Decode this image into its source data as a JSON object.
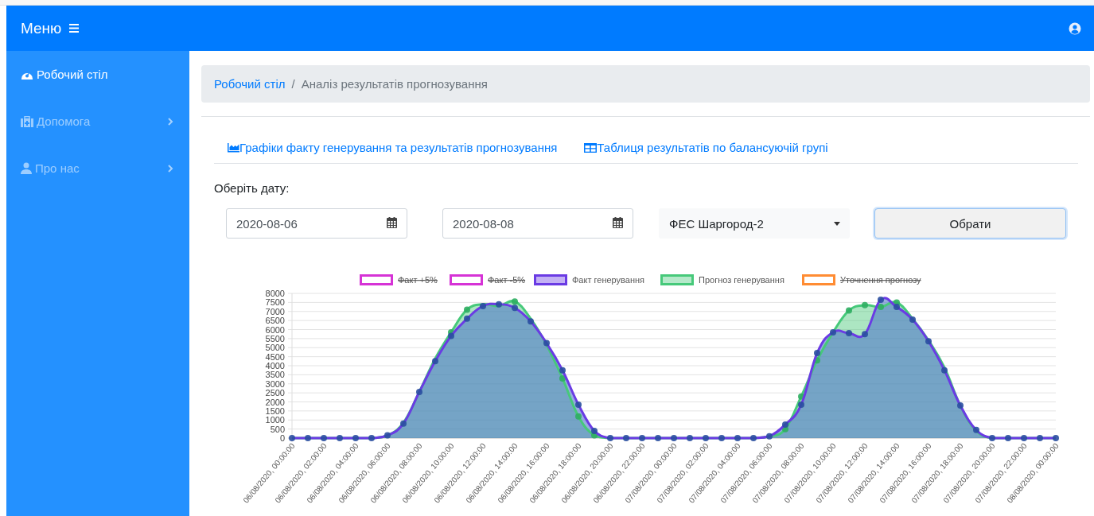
{
  "top_bar": {
    "title": "Меню"
  },
  "sidebar": {
    "items": [
      {
        "label": "Робочий стіл",
        "selected": true,
        "expandable": false
      },
      {
        "label": "Допомога",
        "selected": false,
        "expandable": true
      },
      {
        "label": "Про нас",
        "selected": false,
        "expandable": true
      }
    ]
  },
  "breadcrumb": {
    "separator": "/",
    "items": [
      {
        "label": "Робочий стіл",
        "kind": "link"
      },
      {
        "label": "Аналіз результатів прогнозування",
        "kind": "current"
      }
    ]
  },
  "tabs": [
    {
      "label": "Графіки факту генерування та результатів прогнозування"
    },
    {
      "label": "Таблиця результатів по балансуючій групі"
    }
  ],
  "form": {
    "date_label": "Оберіть дату:",
    "date_from": "2020-08-06",
    "date_to": "2020-08-08",
    "station": "ФЕС Шаргород-2",
    "submit": "Обрати"
  },
  "chart": {
    "legend_items": [
      {
        "hidden": true
      },
      {
        "hidden": true
      },
      {
        "hidden": false
      },
      {
        "hidden": false
      },
      {
        "hidden": true
      }
    ],
    "chart_data": {
      "type": "area",
      "grid": true,
      "legend": true,
      "categories": [
        "06/08/2020, 00:00:00",
        null,
        "06/08/2020, 02:00:00",
        null,
        "06/08/2020, 04:00:00",
        null,
        "06/08/2020, 06:00:00",
        null,
        "06/08/2020, 08:00:00",
        null,
        "06/08/2020, 10:00:00",
        null,
        "06/08/2020, 12:00:00",
        null,
        "06/08/2020, 14:00:00",
        null,
        "06/08/2020, 16:00:00",
        null,
        "06/08/2020, 18:00:00",
        null,
        "06/08/2020, 20:00:00",
        null,
        "06/08/2020, 22:00:00",
        null,
        "07/08/2020, 00:00:00",
        null,
        "07/08/2020, 02:00:00",
        null,
        "07/08/2020, 04:00:00",
        null,
        "07/08/2020, 06:00:00",
        null,
        "07/08/2020, 08:00:00",
        null,
        "07/08/2020, 10:00:00",
        null,
        "07/08/2020, 12:00:00",
        null,
        "07/08/2020, 14:00:00",
        null,
        "07/08/2020, 16:00:00",
        null,
        "07/08/2020, 18:00:00",
        null,
        "07/08/2020, 20:00:00",
        null,
        "07/08/2020, 22:00:00",
        null,
        "08/08/2020, 00:00:00"
      ],
      "ylim": [
        0,
        8000
      ],
      "yticks": [
        0,
        500,
        1000,
        1500,
        2000,
        2500,
        3000,
        3500,
        4000,
        4500,
        5000,
        5500,
        6000,
        6500,
        7000,
        7500,
        8000
      ],
      "series": [
        {
          "name": "Факт +5%",
          "color": "#d633d6",
          "values": [
            null,
            null,
            null,
            null,
            null,
            null,
            null,
            null,
            null,
            null,
            null,
            null,
            null,
            null,
            null,
            null,
            null,
            null,
            null,
            null,
            null,
            null,
            null,
            null,
            null,
            null,
            null,
            null,
            null,
            null,
            null,
            null,
            null,
            null,
            null,
            null,
            null,
            null,
            null,
            null,
            null,
            null,
            null,
            null,
            null,
            null,
            null,
            null,
            null
          ]
        },
        {
          "name": "Факт -5%",
          "color": "#d633d6",
          "values": [
            null,
            null,
            null,
            null,
            null,
            null,
            null,
            null,
            null,
            null,
            null,
            null,
            null,
            null,
            null,
            null,
            null,
            null,
            null,
            null,
            null,
            null,
            null,
            null,
            null,
            null,
            null,
            null,
            null,
            null,
            null,
            null,
            null,
            null,
            null,
            null,
            null,
            null,
            null,
            null,
            null,
            null,
            null,
            null,
            null,
            null,
            null,
            null,
            null
          ]
        },
        {
          "name": "Факт генерування",
          "color": "#6a3be4",
          "values": [
            0,
            0,
            0,
            0,
            0,
            0,
            150,
            800,
            2550,
            4250,
            5650,
            6600,
            7300,
            7400,
            7200,
            6450,
            5250,
            3750,
            1850,
            400,
            0,
            0,
            0,
            0,
            0,
            0,
            0,
            0,
            0,
            0,
            100,
            750,
            1850,
            4700,
            5850,
            5800,
            5750,
            7650,
            7250,
            6550,
            5350,
            3750,
            1800,
            450,
            0,
            0,
            0,
            0,
            0
          ]
        },
        {
          "name": "Прогноз генерування",
          "color": "#46c97a",
          "values": [
            0,
            0,
            0,
            0,
            0,
            0,
            150,
            850,
            2550,
            4400,
            5850,
            7100,
            7400,
            7300,
            7550,
            6600,
            5150,
            3300,
            1200,
            150,
            0,
            0,
            0,
            0,
            0,
            0,
            0,
            0,
            0,
            0,
            100,
            500,
            2300,
            4300,
            5850,
            7050,
            7350,
            7250,
            7500,
            6600,
            5400,
            3900,
            1800,
            400,
            0,
            0,
            0,
            0,
            0
          ]
        },
        {
          "name": "Уточнення прогнозу",
          "color": "#ff8c33",
          "values": [
            null,
            null,
            null,
            null,
            null,
            null,
            null,
            null,
            null,
            null,
            null,
            null,
            null,
            null,
            null,
            null,
            null,
            null,
            null,
            null,
            null,
            null,
            null,
            null,
            null,
            null,
            null,
            null,
            null,
            null,
            null,
            null,
            null,
            null,
            null,
            null,
            null,
            null,
            null,
            null,
            null,
            null,
            null,
            null,
            null,
            null,
            null,
            null,
            null
          ]
        }
      ]
    }
  }
}
